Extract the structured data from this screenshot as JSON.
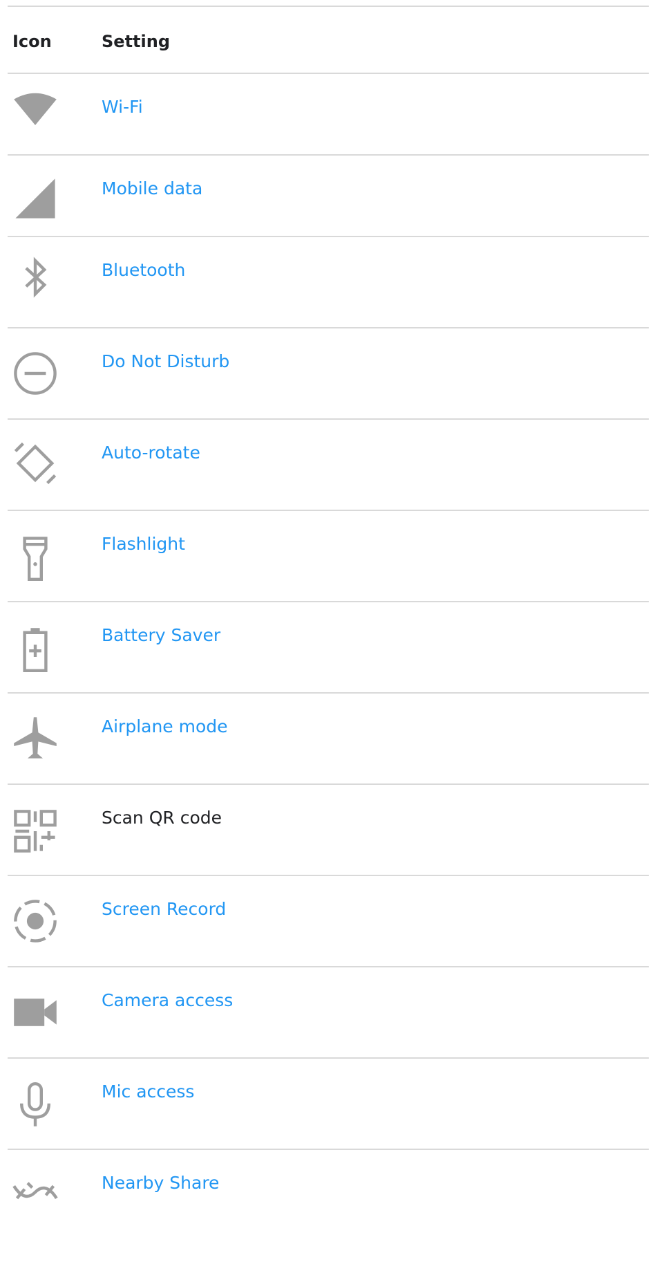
{
  "table": {
    "headers": {
      "icon": "Icon",
      "setting": "Setting"
    },
    "rows": [
      {
        "icon": "wifi-icon",
        "label": "Wi-Fi",
        "link": true
      },
      {
        "icon": "mobile-data-icon",
        "label": "Mobile data",
        "link": true
      },
      {
        "icon": "bluetooth-icon",
        "label": "Bluetooth",
        "link": true
      },
      {
        "icon": "do-not-disturb-icon",
        "label": "Do Not Disturb",
        "link": true
      },
      {
        "icon": "auto-rotate-icon",
        "label": "Auto-rotate",
        "link": true
      },
      {
        "icon": "flashlight-icon",
        "label": "Flashlight",
        "link": true
      },
      {
        "icon": "battery-saver-icon",
        "label": "Battery Saver",
        "link": true
      },
      {
        "icon": "airplane-icon",
        "label": "Airplane mode",
        "link": true
      },
      {
        "icon": "qr-code-icon",
        "label": "Scan QR code",
        "link": false
      },
      {
        "icon": "screen-record-icon",
        "label": "Screen Record",
        "link": true
      },
      {
        "icon": "camera-icon",
        "label": "Camera access",
        "link": true
      },
      {
        "icon": "mic-icon",
        "label": "Mic access",
        "link": true
      },
      {
        "icon": "nearby-share-icon",
        "label": "Nearby Share",
        "link": true
      }
    ]
  },
  "colors": {
    "link": "#2196f3",
    "text": "#202124",
    "icon": "#9e9e9e",
    "rule": "#d9d9d9"
  }
}
